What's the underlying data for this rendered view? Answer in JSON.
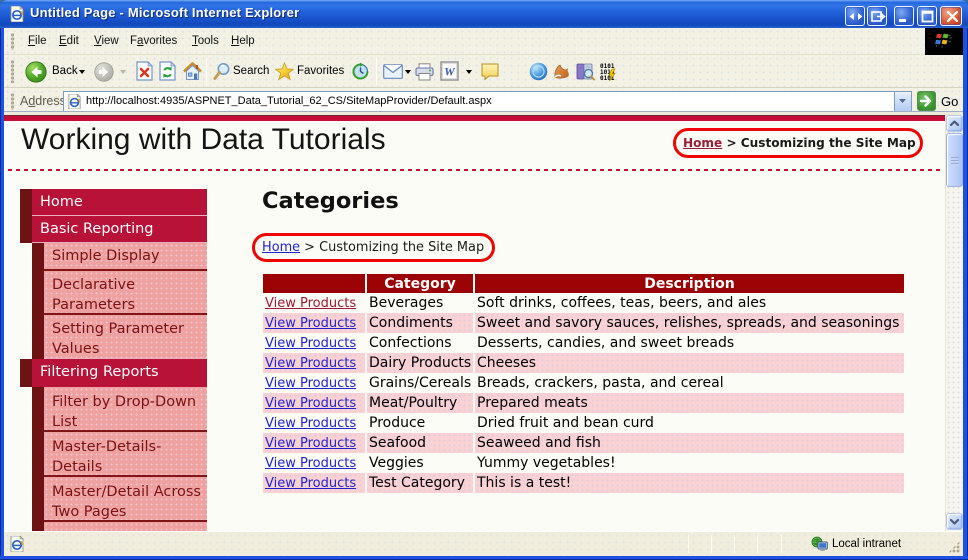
{
  "window": {
    "title": "Untitled Page - Microsoft Internet Explorer",
    "buttons": [
      "resize-horizontal",
      "pop-out",
      "minimize",
      "maximize",
      "close"
    ]
  },
  "menu_bar": {
    "items": [
      {
        "pre": "",
        "accel": "F",
        "post": "ile"
      },
      {
        "pre": "",
        "accel": "E",
        "post": "dit"
      },
      {
        "pre": "",
        "accel": "V",
        "post": "iew"
      },
      {
        "pre": "F",
        "accel": "a",
        "post": "vorites"
      },
      {
        "pre": "",
        "accel": "T",
        "post": "ools"
      },
      {
        "pre": "",
        "accel": "H",
        "post": "elp"
      }
    ]
  },
  "toolbar": {
    "back_label": "Back",
    "search_label": "Search",
    "favorites_label": "Favorites"
  },
  "address_bar": {
    "label_pre": "A",
    "label_accel": "d",
    "label_post": "dress",
    "url": "http://localhost:4935/ASPNET_Data_Tutorial_62_CS/SiteMapProvider/Default.aspx",
    "go_label": "Go"
  },
  "page": {
    "site_title": "Working with Data Tutorials",
    "breadcrumb_top": {
      "home": "Home",
      "rest": " > Customizing the Site Map"
    },
    "content_heading": "Categories",
    "breadcrumb_content": {
      "home": "Home",
      "rest": " > Customizing the Site Map"
    },
    "sidebar": {
      "items": [
        {
          "label": "Home",
          "level": 1
        },
        {
          "label": "Basic Reporting",
          "level": 1
        },
        {
          "label": "Simple Display",
          "level": 2
        },
        {
          "label": "Declarative Parameters",
          "level": 2
        },
        {
          "label": "Setting Parameter Values",
          "level": 2
        },
        {
          "label": "Filtering Reports",
          "level": 1
        },
        {
          "label": "Filter by Drop-Down List",
          "level": 2
        },
        {
          "label": "Master-Details-Details",
          "level": 2
        },
        {
          "label": "Master/Detail Across Two Pages",
          "level": 2
        },
        {
          "label": "",
          "level": 2
        }
      ]
    },
    "table": {
      "headers": [
        "",
        "Category",
        "Description"
      ],
      "rows": [
        {
          "link": "View Products",
          "category": "Beverages",
          "description": "Soft drinks, coffees, teas, beers, and ales"
        },
        {
          "link": "View Products",
          "category": "Condiments",
          "description": "Sweet and savory sauces, relishes, spreads, and seasonings"
        },
        {
          "link": "View Products",
          "category": "Confections",
          "description": "Desserts, candies, and sweet breads"
        },
        {
          "link": "View Products",
          "category": "Dairy Products",
          "description": "Cheeses"
        },
        {
          "link": "View Products",
          "category": "Grains/Cereals",
          "description": "Breads, crackers, pasta, and cereal"
        },
        {
          "link": "View Products",
          "category": "Meat/Poultry",
          "description": "Prepared meats"
        },
        {
          "link": "View Products",
          "category": "Produce",
          "description": "Dried fruit and bean curd"
        },
        {
          "link": "View Products",
          "category": "Seafood",
          "description": "Seaweed and fish"
        },
        {
          "link": "View Products",
          "category": "Veggies",
          "description": "Yummy vegetables!"
        },
        {
          "link": "View Products",
          "category": "Test Category",
          "description": "This is a test!"
        }
      ]
    }
  },
  "status_bar": {
    "zone_label": "Local intranet"
  },
  "colors": {
    "titlebar_blue": "#1C51E3",
    "page_topbar_red": "#C60D36",
    "menu_level1_red": "#B81238",
    "menu_level2_pink": "#EFA1A0",
    "menu_strip_maroon": "#6E1313",
    "table_header_maroon": "#9B0304",
    "table_pink_row": "#FBD2D3",
    "link_blue": "#2222CC",
    "visited_maroon": "#9C1A33",
    "annotation_red": "#EE0400"
  }
}
